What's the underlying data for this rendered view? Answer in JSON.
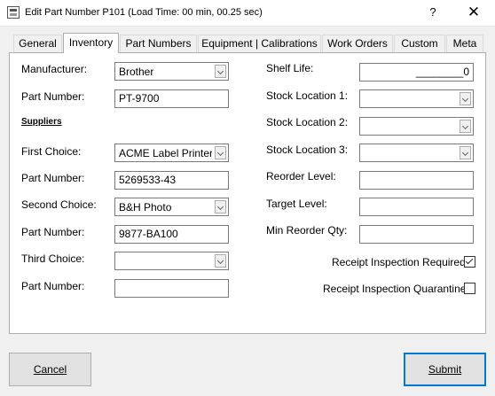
{
  "window": {
    "title": "Edit Part Number P101 (Load Time: 00 min, 00.25 sec)",
    "help": "?",
    "close": "✕"
  },
  "tabs": [
    {
      "label": "General"
    },
    {
      "label": "Inventory",
      "active": true
    },
    {
      "label": "Part Numbers"
    },
    {
      "label": "Equipment | Calibrations"
    },
    {
      "label": "Work Orders"
    },
    {
      "label": "Custom"
    },
    {
      "label": "Meta"
    }
  ],
  "left": {
    "manufacturer_label": "Manufacturer:",
    "manufacturer_value": "Brother",
    "part_number_label": "Part Number:",
    "part_number_value": "PT-9700",
    "suppliers_heading": "Suppliers",
    "first_choice_label": "First Choice:",
    "first_choice_value": "ACME Label Printers",
    "first_part_label": "Part Number:",
    "first_part_value": "5269533-43",
    "second_choice_label": "Second Choice:",
    "second_choice_value": "B&H Photo",
    "second_part_label": "Part Number:",
    "second_part_value": "9877-BA100",
    "third_choice_label": "Third Choice:",
    "third_choice_value": "",
    "third_part_label": "Part Number:",
    "third_part_value": ""
  },
  "right": {
    "shelf_life_label": "Shelf Life:",
    "shelf_life_value": "________0",
    "stock_loc1_label": "Stock Location 1:",
    "stock_loc1_value": "",
    "stock_loc2_label": "Stock Location 2:",
    "stock_loc2_value": "",
    "stock_loc3_label": "Stock Location 3:",
    "stock_loc3_value": "",
    "reorder_level_label": "Reorder Level:",
    "reorder_level_value": "",
    "target_level_label": "Target Level:",
    "target_level_value": "",
    "min_reorder_label": "Min Reorder Qty:",
    "min_reorder_value": "",
    "receipt_inspection_required_label": "Receipt Inspection Required",
    "receipt_inspection_required_checked": true,
    "receipt_inspection_quarantine_label": "Receipt Inspection Quarantine",
    "receipt_inspection_quarantine_checked": false
  },
  "buttons": {
    "cancel_label": "Cancel",
    "submit_label": "Submit"
  },
  "colors": {
    "default_button_border": "#0078d7",
    "background": "#f0f0f0",
    "panel": "#ffffff"
  }
}
